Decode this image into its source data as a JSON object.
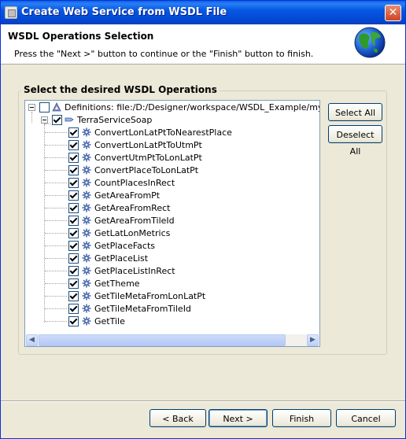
{
  "window": {
    "title": "Create Web Service from WSDL File",
    "close_glyph": "✕"
  },
  "header": {
    "title": "WSDL Operations Selection",
    "description": "Press the \"Next >\" button to continue or the \"Finish\" button to finish.",
    "icon": "globe-icon"
  },
  "group": {
    "label": "Select the desired WSDL Operations"
  },
  "tree": {
    "root": {
      "label": "Definitions: file:/D:/Designer/workspace/WSDL_Example/mywsdls/T",
      "checked": false,
      "icon": "definitions-icon"
    },
    "service": {
      "label": "TerraServiceSoap",
      "checked": true,
      "icon": "service-icon"
    },
    "operations": [
      {
        "label": "ConvertLonLatPtToNearestPlace",
        "checked": true
      },
      {
        "label": "ConvertLonLatPtToUtmPt",
        "checked": true
      },
      {
        "label": "ConvertUtmPtToLonLatPt",
        "checked": true
      },
      {
        "label": "ConvertPlaceToLonLatPt",
        "checked": true
      },
      {
        "label": "CountPlacesInRect",
        "checked": true
      },
      {
        "label": "GetAreaFromPt",
        "checked": true
      },
      {
        "label": "GetAreaFromRect",
        "checked": true
      },
      {
        "label": "GetAreaFromTileId",
        "checked": true
      },
      {
        "label": "GetLatLonMetrics",
        "checked": true
      },
      {
        "label": "GetPlaceFacts",
        "checked": true
      },
      {
        "label": "GetPlaceList",
        "checked": true
      },
      {
        "label": "GetPlaceListInRect",
        "checked": true
      },
      {
        "label": "GetTheme",
        "checked": true
      },
      {
        "label": "GetTileMetaFromLonLatPt",
        "checked": true
      },
      {
        "label": "GetTileMetaFromTileId",
        "checked": true
      },
      {
        "label": "GetTile",
        "checked": true
      }
    ]
  },
  "side_buttons": {
    "select_all": "Select All",
    "deselect_all": "Deselect All"
  },
  "footer": {
    "back": "< Back",
    "next": "Next >",
    "finish": "Finish",
    "cancel": "Cancel"
  },
  "colors": {
    "titlebar": "#0558e3",
    "accent": "#0831d9",
    "dialog_bg": "#ece9d8"
  }
}
